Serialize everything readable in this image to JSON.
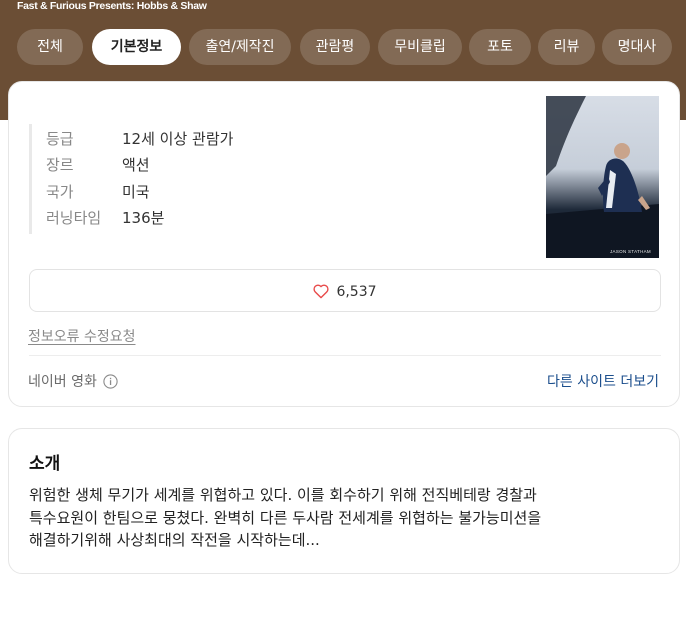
{
  "header": {
    "title": "Fast & Furious Presents: Hobbs & Shaw"
  },
  "tabs": [
    {
      "label": "전체",
      "active": false
    },
    {
      "label": "기본정보",
      "active": true
    },
    {
      "label": "출연/제작진",
      "active": false
    },
    {
      "label": "관람평",
      "active": false
    },
    {
      "label": "무비클립",
      "active": false
    },
    {
      "label": "포토",
      "active": false
    },
    {
      "label": "리뷰",
      "active": false
    },
    {
      "label": "명대사",
      "active": false
    }
  ],
  "info": {
    "rows": [
      {
        "key": "등급",
        "value": "12세 이상 관람가"
      },
      {
        "key": "장르",
        "value": "액션"
      },
      {
        "key": "국가",
        "value": "미국"
      },
      {
        "key": "러닝타임",
        "value": "136분"
      }
    ],
    "poster_caption": "JASON STATHAM"
  },
  "like": {
    "icon": "heart-outline-icon",
    "count": "6,537",
    "color": "#e84a4a"
  },
  "links": {
    "edit": "정보오류 수정요청",
    "source": "네이버 영화",
    "source_icon": "info-circle-icon",
    "more": "다른 사이트 더보기"
  },
  "intro": {
    "title": "소개",
    "lines": [
      "위험한 생체 무기가 세계를 위협하고 있다. 이를 회수하기 위해 전직베테랑 경찰과",
      "특수요원이 한팀으로 뭉쳤다. 완벽히 다른 두사람 전세계를 위협하는 불가능미션을",
      "해결하기위해 사상최대의 작전을 시작하는데..."
    ]
  },
  "colors": {
    "header_bg": "#6b4e35",
    "link_blue": "#1b4e8c"
  }
}
